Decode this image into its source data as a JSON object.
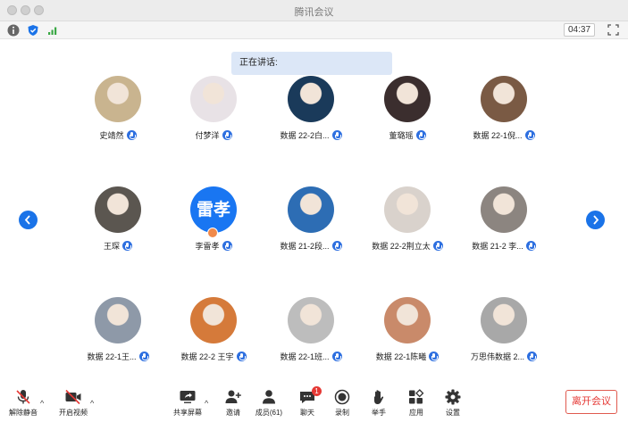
{
  "window": {
    "title": "腾讯会议"
  },
  "status": {
    "timer": "04:37"
  },
  "speaking": {
    "label": "正在讲话:"
  },
  "participants": [
    {
      "name": "史靖然",
      "avatar": "photo",
      "color": "#c9b48f"
    },
    {
      "name": "付梦洋",
      "avatar": "anime",
      "color": "#e8e2e6"
    },
    {
      "name": "数据 22-2白...",
      "avatar": "photo",
      "color": "#1a3a5a"
    },
    {
      "name": "董璐瑶",
      "avatar": "photo",
      "color": "#3b2e2e"
    },
    {
      "name": "数据 22-1倪...",
      "avatar": "photo",
      "color": "#7a5a44"
    },
    {
      "name": "王琛",
      "avatar": "photo",
      "color": "#5b5650"
    },
    {
      "name": "李雷孝",
      "avatar_text": "雷孝",
      "avatar": "text",
      "color": "#1976f2",
      "host": true
    },
    {
      "name": "数据 21-2段...",
      "avatar": "photo",
      "color": "#2d6db4"
    },
    {
      "name": "数据 22-2荆立太",
      "avatar": "photo",
      "color": "#d9d2cc"
    },
    {
      "name": "数据 21-2 李...",
      "avatar": "photo",
      "color": "#8c8580"
    },
    {
      "name": "数据 22-1王...",
      "avatar": "photo",
      "color": "#8e99a8"
    },
    {
      "name": "数据 22-2 王宇",
      "avatar": "photo",
      "color": "#d57a3a"
    },
    {
      "name": "数据 22-1班...",
      "avatar": "photo",
      "color": "#bdbdbd"
    },
    {
      "name": "数据 22-1陈曦",
      "avatar": "photo",
      "color": "#c98a6a"
    },
    {
      "name": "万思伟数据 2...",
      "avatar": "photo",
      "color": "#a8a8a8"
    }
  ],
  "toolbar": {
    "unmute": "解除静音",
    "start_video": "开启视频",
    "share_screen": "共享屏幕",
    "invite": "邀请",
    "members": "成员(61)",
    "chat": "聊天",
    "chat_badge": "1",
    "record": "录制",
    "raise_hand": "举手",
    "apps": "应用",
    "settings": "设置",
    "leave": "离开会议"
  },
  "colors": {
    "accent": "#1a73e8",
    "danger": "#e53935",
    "speaking_bg": "#dce7f7"
  }
}
